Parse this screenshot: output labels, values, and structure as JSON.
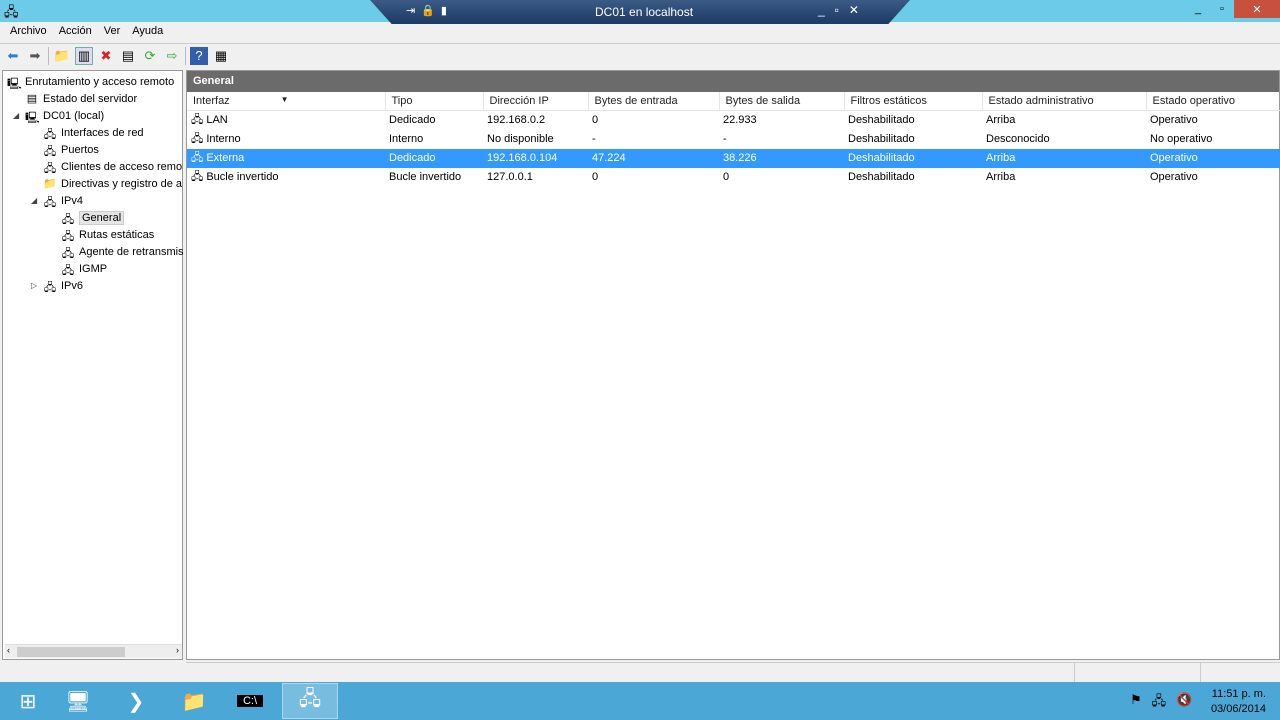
{
  "window": {
    "title": "DC01 en localhost",
    "minimize": "_",
    "restore": "▫",
    "close": "✕"
  },
  "menu": [
    "Archivo",
    "Acción",
    "Ver",
    "Ayuda"
  ],
  "tree": [
    {
      "label": "Enrutamiento y acceso remoto",
      "icon": "server-icon",
      "level": 0
    },
    {
      "label": "Estado del servidor",
      "icon": "server-status-icon",
      "level": 1
    },
    {
      "label": "DC01 (local)",
      "icon": "server-local-icon",
      "level": 1,
      "expanded": true
    },
    {
      "label": "Interfaces de red",
      "icon": "network-icon",
      "level": 2
    },
    {
      "label": "Puertos",
      "icon": "network-icon",
      "level": 2
    },
    {
      "label": "Clientes de acceso remo",
      "icon": "network-icon",
      "level": 2
    },
    {
      "label": "Directivas y registro de a",
      "icon": "folder-icon",
      "level": 2
    },
    {
      "label": "IPv4",
      "icon": "network-icon",
      "level": 2,
      "expanded": true
    },
    {
      "label": "General",
      "icon": "network-icon",
      "level": 3,
      "selected": true
    },
    {
      "label": "Rutas estáticas",
      "icon": "network-icon",
      "level": 3
    },
    {
      "label": "Agente de retransmis",
      "icon": "network-icon",
      "level": 3
    },
    {
      "label": "IGMP",
      "icon": "network-icon",
      "level": 3
    },
    {
      "label": "IPv6",
      "icon": "network-icon",
      "level": 2,
      "expanded": false
    }
  ],
  "panel": {
    "title": "General",
    "columns": [
      "Interfaz",
      "Tipo",
      "Dirección IP",
      "Bytes de entrada",
      "Bytes de salida",
      "Filtros estáticos",
      "Estado administrativo",
      "Estado operativo"
    ],
    "rows": [
      [
        "LAN",
        "Dedicado",
        "192.168.0.2",
        "0",
        "22.933",
        "Deshabilitado",
        "Arriba",
        "Operativo"
      ],
      [
        "Interno",
        "Interno",
        "No disponible",
        "-",
        "-",
        "Deshabilitado",
        "Desconocido",
        "No operativo"
      ],
      [
        "Externa",
        "Dedicado",
        "192.168.0.104",
        "47.224",
        "38.226",
        "Deshabilitado",
        "Arriba",
        "Operativo"
      ],
      [
        "Bucle invertido",
        "Bucle invertido",
        "127.0.0.1",
        "0",
        "0",
        "Deshabilitado",
        "Arriba",
        "Operativo"
      ]
    ],
    "selected_row": 2
  },
  "clock": {
    "time": "11:51 p. m.",
    "date": "03/06/2014"
  }
}
